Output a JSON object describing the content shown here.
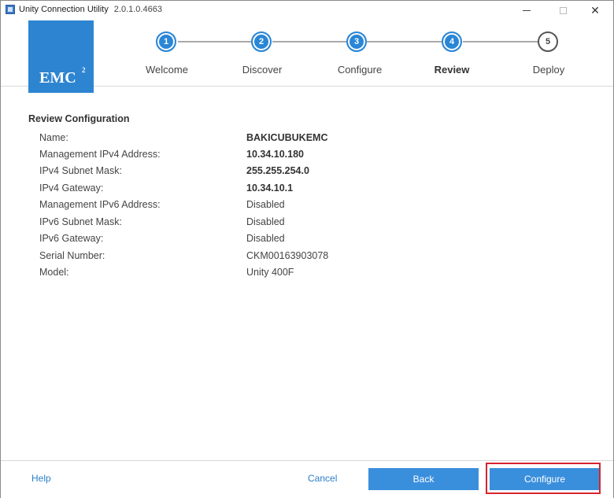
{
  "window": {
    "title": "Unity Connection Utility",
    "version": "2.0.1.0.4663"
  },
  "logo": {
    "text": "EMC",
    "superscript": "2"
  },
  "steps": [
    {
      "number": "1",
      "label": "Welcome",
      "state": "done"
    },
    {
      "number": "2",
      "label": "Discover",
      "state": "done"
    },
    {
      "number": "3",
      "label": "Configure",
      "state": "done"
    },
    {
      "number": "4",
      "label": "Review",
      "state": "current"
    },
    {
      "number": "5",
      "label": "Deploy",
      "state": "todo"
    }
  ],
  "review": {
    "title": "Review Configuration",
    "rows": [
      {
        "label": "Name:",
        "value": "BAKICUBUKEMC"
      },
      {
        "label": "Management IPv4 Address:",
        "value": "10.34.10.180"
      },
      {
        "label": "IPv4 Subnet Mask:",
        "value": "255.255.254.0"
      },
      {
        "label": "IPv4 Gateway:",
        "value": "10.34.10.1"
      },
      {
        "label": "Management IPv6 Address:",
        "value": "Disabled"
      },
      {
        "label": "IPv6 Subnet Mask:",
        "value": "Disabled"
      },
      {
        "label": "IPv6 Gateway:",
        "value": "Disabled"
      },
      {
        "label": "Serial Number:",
        "value": "CKM00163903078"
      },
      {
        "label": "Model:",
        "value": "Unity 400F"
      }
    ]
  },
  "footer": {
    "help_label": "Help",
    "cancel_label": "Cancel",
    "back_label": "Back",
    "configure_label": "Configure"
  },
  "colors": {
    "accent": "#2a86d6",
    "button": "#3a8fdc",
    "link": "#2a7fc9",
    "highlight": "#d8242f"
  },
  "icons": {
    "app": "app-icon",
    "minimize": "minimize-icon",
    "maximize": "maximize-icon",
    "close": "close-icon"
  }
}
